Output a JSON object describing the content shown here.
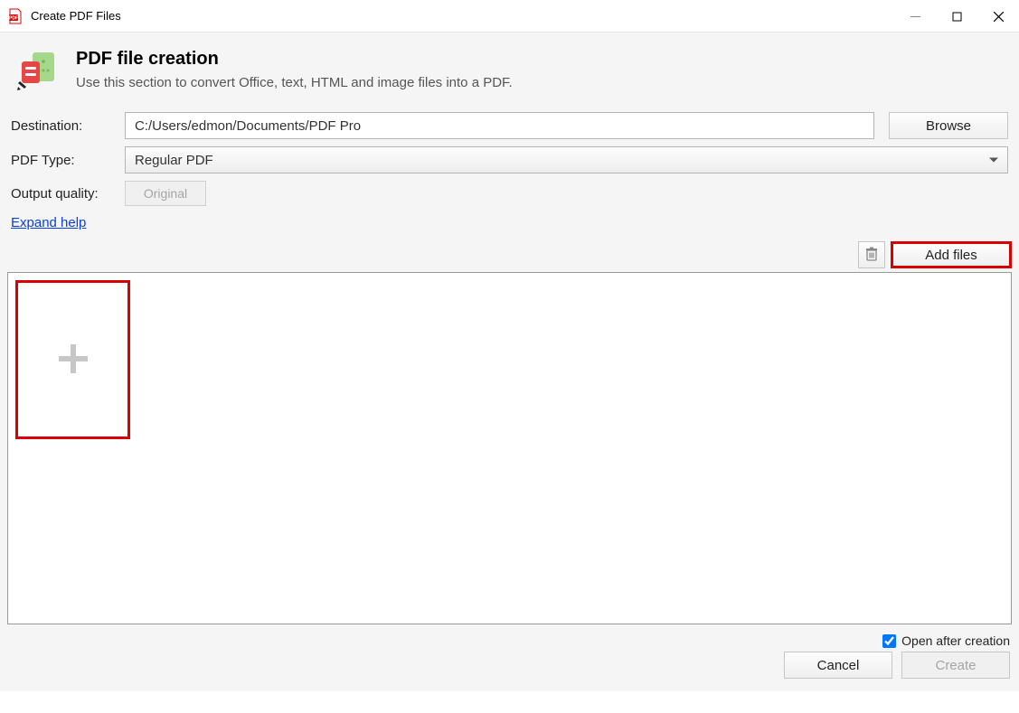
{
  "window": {
    "title": "Create PDF Files"
  },
  "header": {
    "title": "PDF file creation",
    "subtitle": "Use this section to convert Office, text, HTML and image files into a PDF."
  },
  "form": {
    "destination_label": "Destination:",
    "destination_value": "C:/Users/edmon/Documents/PDF Pro",
    "browse_label": "Browse",
    "pdftype_label": "PDF Type:",
    "pdftype_value": "Regular PDF",
    "quality_label": "Output quality:",
    "quality_value": "Original",
    "expand_help": "Expand help"
  },
  "toolbar": {
    "addfiles_label": "Add files"
  },
  "footer": {
    "open_after_label": "Open after creation",
    "open_after_checked": true,
    "cancel_label": "Cancel",
    "create_label": "Create"
  }
}
